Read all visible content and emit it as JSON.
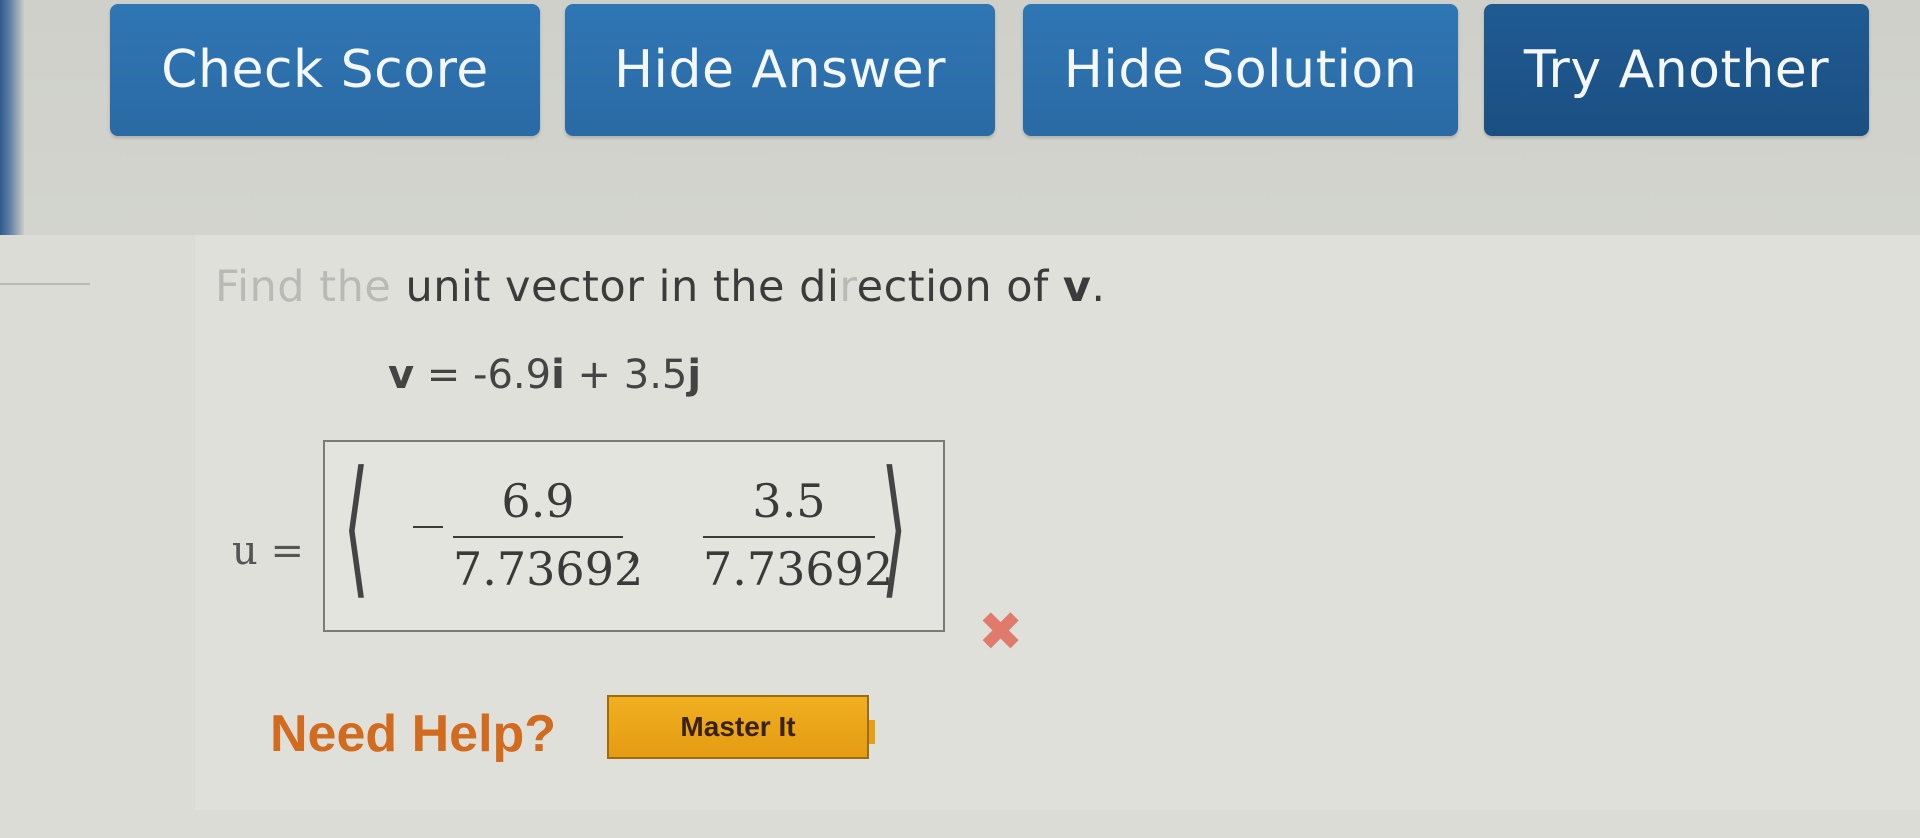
{
  "toolbar": {
    "check_score": "Check Score",
    "hide_answer": "Hide Answer",
    "hide_solution": "Hide Solution",
    "try_another": "Try Another"
  },
  "question": {
    "prefix_faded": "Find the",
    "text": " unit vector in the di",
    "faded_mid": "r",
    "text2": "ection of ",
    "vector": "v",
    "period": "."
  },
  "given": {
    "lhs": "v",
    "rhs_a": " = -6.9",
    "i": "i",
    "rhs_b": " + 3.5",
    "j": "j"
  },
  "answer": {
    "label": "u =",
    "left_angle": "⟨",
    "right_angle": "⟩",
    "num1": "6.9",
    "den1": "7.73692",
    "num2": "3.5",
    "den2": "7.73692",
    "comma": ","
  },
  "status": {
    "icon": "x-mark-icon",
    "symbol": "✖",
    "color": "#e07a6c"
  },
  "help": {
    "label": "Need Help?",
    "master_it": "Master It"
  },
  "colors": {
    "button_blue": "#2f76b4",
    "help_orange": "#d26b1e",
    "master_gold": "#e59b12"
  }
}
